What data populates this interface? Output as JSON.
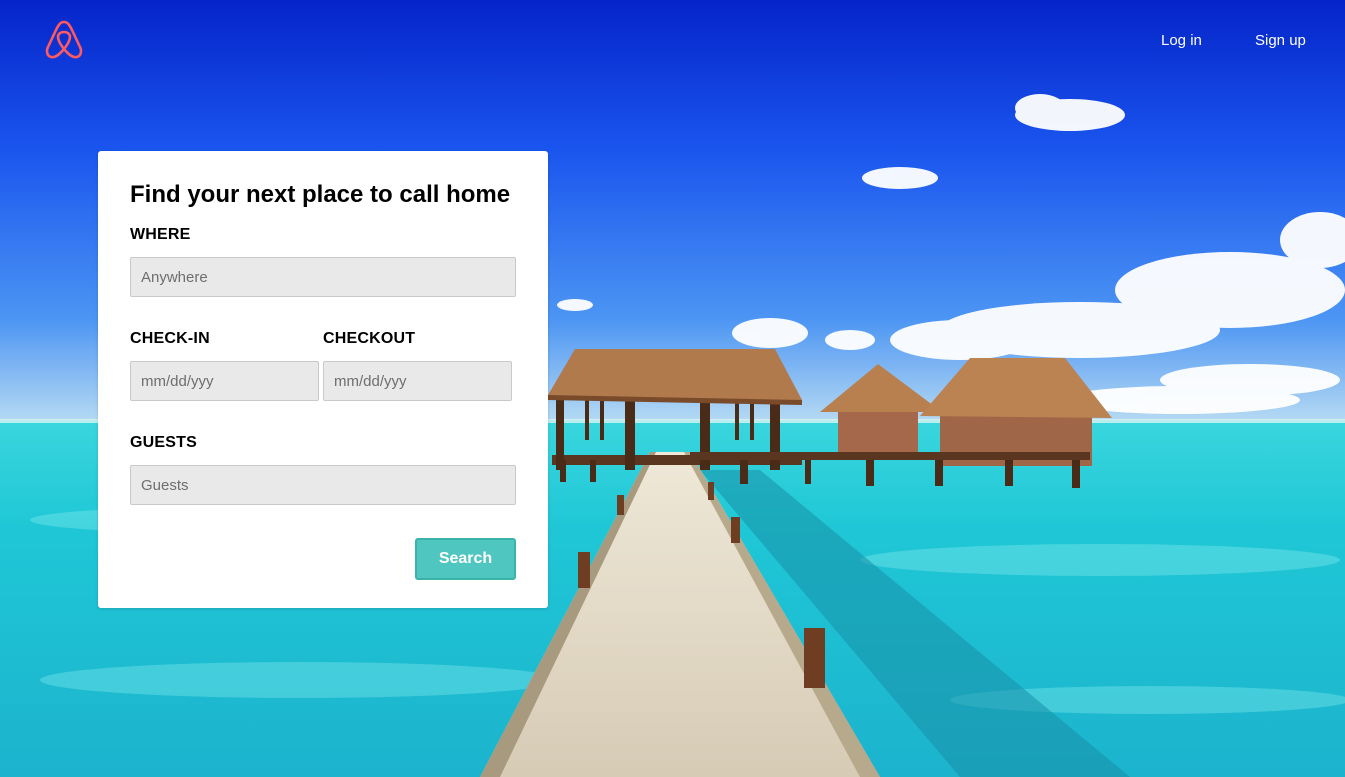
{
  "brand": {
    "logo_icon": "airbnb-belo-icon",
    "logo_color": "#ff5a5f"
  },
  "nav": {
    "login_label": "Log in",
    "signup_label": "Sign up"
  },
  "search_form": {
    "title": "Find your next place to call home",
    "where": {
      "label": "WHERE",
      "placeholder": "Anywhere",
      "value": ""
    },
    "checkin": {
      "label": "CHECK-IN",
      "placeholder": "mm/dd/yyy",
      "value": ""
    },
    "checkout": {
      "label": "CHECKOUT",
      "placeholder": "mm/dd/yyy",
      "value": ""
    },
    "guests": {
      "label": "GUESTS",
      "placeholder": "Guests",
      "value": ""
    },
    "search_label": "Search",
    "search_color": "#4fc6bf"
  },
  "hero": {
    "image_subject": "overwater-bungalows-tropical-beach"
  }
}
